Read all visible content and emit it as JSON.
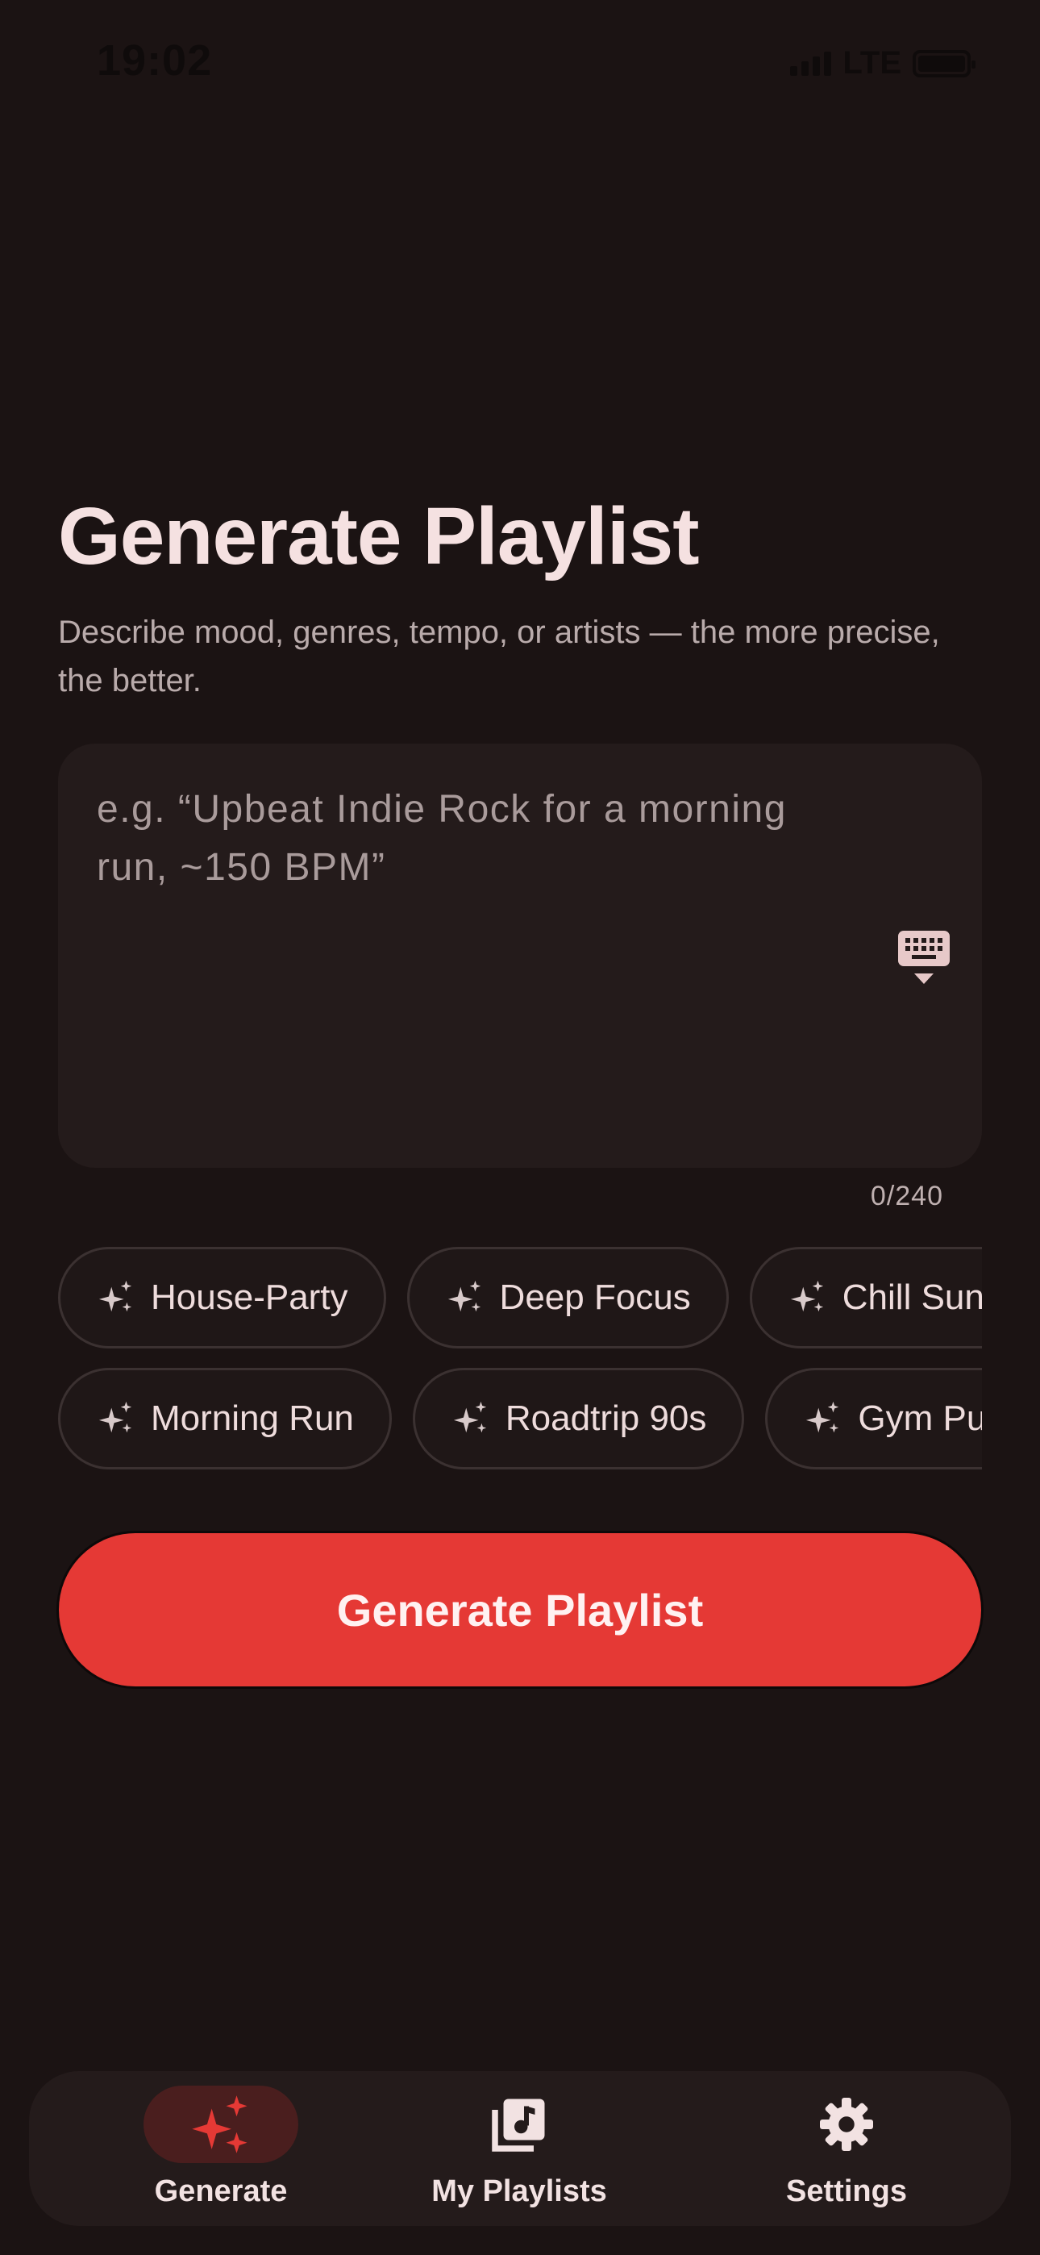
{
  "status_bar": {
    "time": "19:02",
    "network": "LTE"
  },
  "header": {
    "title": "Generate Playlist",
    "subtitle": "Describe mood, genres, tempo, or artists — the more precise, the better."
  },
  "prompt": {
    "placeholder": "e.g. “Upbeat Indie Rock for a morning run, ~150 BPM”",
    "value": "",
    "counter": "0/240",
    "icon": "keyboard-hide-icon"
  },
  "suggestions": {
    "row1": [
      "House-Party",
      "Deep Focus",
      "Chill Sunday"
    ],
    "row2": [
      "Morning Run",
      "Roadtrip 90s",
      "Gym Pump"
    ],
    "icon": "sparkle-icon"
  },
  "generate_button": {
    "label": "Generate Playlist"
  },
  "nav": {
    "items": [
      {
        "label": "Generate",
        "icon": "sparkles-icon",
        "active": true
      },
      {
        "label": "My Playlists",
        "icon": "music-library-icon",
        "active": false
      },
      {
        "label": "Settings",
        "icon": "gear-icon",
        "active": false
      }
    ]
  },
  "colors": {
    "background": "#1b1313",
    "surface": "#241b1b",
    "accent": "#e53935",
    "active_pill": "#4a1e1e",
    "text_primary": "#f5e1e1",
    "text_secondary": "#b9abab"
  }
}
